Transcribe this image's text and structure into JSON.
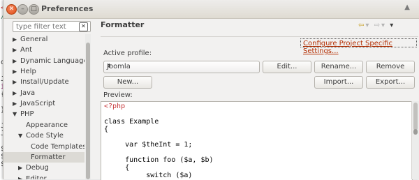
{
  "window": {
    "title": "Preferences"
  },
  "filter": {
    "placeholder": "type filter text"
  },
  "tree": {
    "items": [
      {
        "label": "General",
        "expanded": false
      },
      {
        "label": "Ant",
        "expanded": false
      },
      {
        "label": "Dynamic Languages",
        "expanded": false
      },
      {
        "label": "Help",
        "expanded": false
      },
      {
        "label": "Install/Update",
        "expanded": false
      },
      {
        "label": "Java",
        "expanded": false
      },
      {
        "label": "JavaScript",
        "expanded": false
      },
      {
        "label": "PHP",
        "expanded": true
      },
      {
        "label": "Appearance"
      },
      {
        "label": "Code Style",
        "expanded": true
      },
      {
        "label": "Code Templates"
      },
      {
        "label": "Formatter",
        "selected": true
      },
      {
        "label": "Debug",
        "expanded": false
      },
      {
        "label": "Editor",
        "expanded": false
      }
    ]
  },
  "page": {
    "header": "Formatter",
    "configure_link": "Configure Project Specific Settings...",
    "active_profile_label": "Active profile:",
    "profile_value": "Joomla",
    "buttons": {
      "edit": "Edit...",
      "rename": "Rename...",
      "remove": "Remove",
      "new": "New...",
      "import": "Import...",
      "export": "Export..."
    },
    "preview_label": "Preview:",
    "preview_lines": [
      "<?php",
      "",
      "class Example",
      "{",
      "",
      "     var $theInt = 1;",
      "",
      "     function foo ($a, $b)",
      "     {",
      "          switch ($a)"
    ]
  },
  "background_editor": {
    "lines": [
      "<",
      "/",
      "",
      "",
      "",
      "de",
      "",
      "JE",
      "if",
      "{",
      "",
      "}",
      "",
      "JE",
      "JM",
      "",
      "$d",
      "$r",
      "$m"
    ]
  },
  "colors": {
    "link": "#b32d00",
    "php_tag": "#c7383b",
    "close_button": "#df4a16",
    "back_arrow": "#c69d1c"
  }
}
